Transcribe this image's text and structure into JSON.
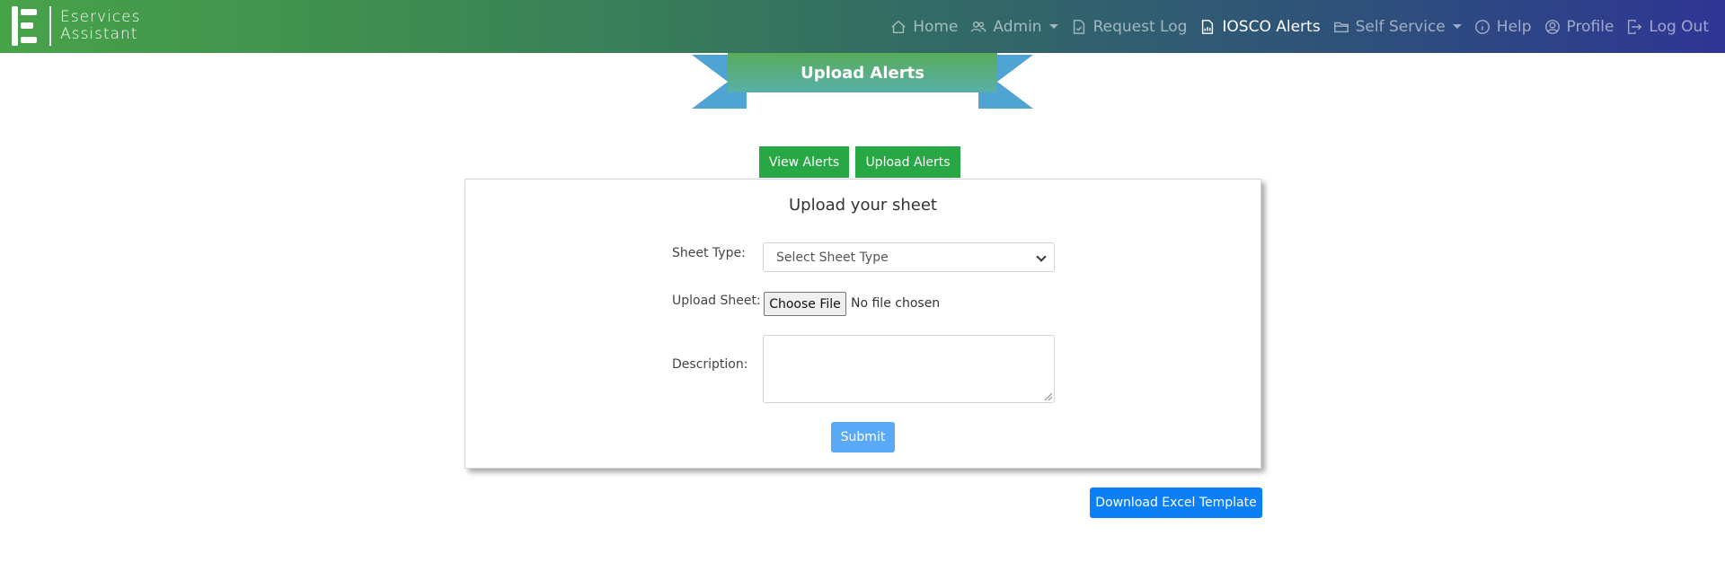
{
  "brand": {
    "line1": "Eservices",
    "line2": "Assistant"
  },
  "nav": {
    "home": "Home",
    "admin": "Admin",
    "request_log": "Request Log",
    "iosco_alerts": "IOSCO Alerts",
    "self_service": "Self Service",
    "help": "Help",
    "profile": "Profile",
    "log_out": "Log Out"
  },
  "ribbon": {
    "title": "Upload Alerts"
  },
  "tabs": {
    "view": "View Alerts",
    "upload": "Upload Alerts"
  },
  "form": {
    "title": "Upload your sheet",
    "sheet_type_label": "Sheet Type:",
    "sheet_type_value": "Select Sheet Type",
    "upload_label": "Upload Sheet:",
    "choose_file": "Choose File",
    "file_status": "No file chosen",
    "description_label": "Description:",
    "submit": "Submit"
  },
  "download": "Download Excel Template",
  "colors": {
    "tab_green": "#28a745",
    "submit_blue": "#5aa9f7",
    "download_blue": "#0d7ff6",
    "ribbon_blue": "#4fa3d3"
  }
}
